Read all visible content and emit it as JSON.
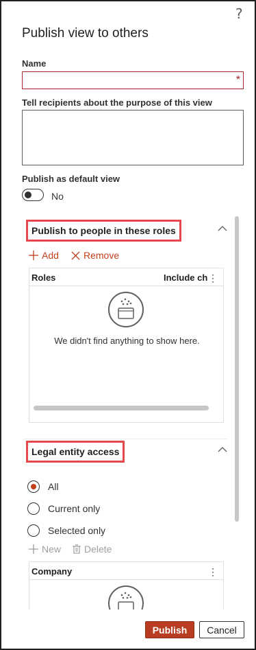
{
  "dialog": {
    "title": "Publish view to others",
    "help_icon": "question-mark-icon"
  },
  "form": {
    "name_label": "Name",
    "name_value": "",
    "required_marker": "*",
    "purpose_label": "Tell recipients about the purpose of this view",
    "purpose_value": "",
    "default_label": "Publish as default view",
    "default_toggle_text": "No",
    "default_toggle_on": false
  },
  "roles_section": {
    "title": "Publish to people in these roles",
    "add_label": "Add",
    "remove_label": "Remove",
    "columns": [
      "Roles",
      "Include ch"
    ],
    "empty_message": "We didn't find anything to show here."
  },
  "legal_section": {
    "title": "Legal entity access",
    "options": [
      {
        "label": "All",
        "checked": true
      },
      {
        "label": "Current only",
        "checked": false
      },
      {
        "label": "Selected only",
        "checked": false
      }
    ],
    "new_label": "New",
    "delete_label": "Delete",
    "columns": [
      "Company"
    ]
  },
  "footer": {
    "publish_label": "Publish",
    "cancel_label": "Cancel"
  },
  "colors": {
    "accent": "#c43e1c",
    "primary_button": "#b83c22",
    "highlight_box": "#e5484d",
    "required": "#a4262c"
  }
}
